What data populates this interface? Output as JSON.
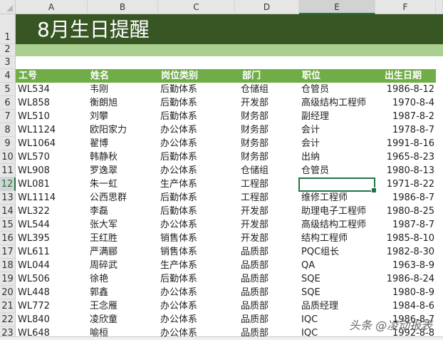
{
  "columns": [
    "A",
    "B",
    "C",
    "D",
    "E",
    "F"
  ],
  "title": "8月生日提醒",
  "headers": [
    "工号",
    "姓名",
    "岗位类别",
    "部门",
    "职位",
    "出生日期"
  ],
  "row_numbers": [
    "1",
    "2",
    "3",
    "4",
    "5",
    "6",
    "7",
    "8",
    "9",
    "10",
    "11",
    "12",
    "13",
    "14",
    "15",
    "16",
    "17",
    "18",
    "19",
    "20",
    "21",
    "22",
    "23"
  ],
  "rows": [
    [
      "WL534",
      "韦刚",
      "后勤体系",
      " 仓储组",
      " 仓管员",
      "1986-8-12"
    ],
    [
      "WL858",
      "衡朗旭",
      "后勤体系",
      " 开发部",
      " 高级结构工程师",
      "1970-8-4"
    ],
    [
      "WL510",
      "刘攀",
      "后勤体系",
      "财务部",
      "副经理",
      "1987-8-2"
    ],
    [
      "WL1124",
      "欧阳家力",
      "办公体系",
      "财务部",
      "会计",
      "1978-8-7"
    ],
    [
      "WL1064",
      "翟博",
      "办公体系",
      "财务部",
      "会计",
      "1991-8-16"
    ],
    [
      "WL570",
      "韩静秋",
      "后勤体系",
      "财务部",
      "出纳",
      "1965-8-23"
    ],
    [
      "WL908",
      "罗逸翠",
      "办公体系",
      "仓储组",
      "仓管员",
      "1980-8-13"
    ],
    [
      "WL081",
      "朱一虹",
      "生产体系",
      "工程部",
      "",
      "1971-8-22"
    ],
    [
      "WL1114",
      "公西思群",
      "后勤体系",
      "工程部",
      "维修工程师",
      "1986-8-7"
    ],
    [
      "WL322",
      "李磊",
      "后勤体系",
      "开发部",
      "助理电子工程师",
      "1980-8-25"
    ],
    [
      "WL544",
      "张大军",
      "办公体系",
      "开发部",
      "高级结构工程师",
      "1987-8-7"
    ],
    [
      "WL395",
      "王红胜",
      "销售体系",
      "开发部",
      "结构工程师",
      "1985-8-10"
    ],
    [
      "WL611",
      "严满郦",
      "销售体系",
      "品质部",
      "PQC组长",
      "1982-8-30"
    ],
    [
      "WL044",
      "周碎武",
      "生产体系",
      "品质部",
      "QA",
      "1963-8-9"
    ],
    [
      "WL506",
      "徐艳",
      "后勤体系",
      "品质部",
      "SQE",
      "1986-8-24"
    ],
    [
      "WL448",
      "郭鑫",
      "办公体系",
      "品质部",
      "SQE",
      "1980-8-9"
    ],
    [
      "WL772",
      "王念雁",
      "办公体系",
      "品质部",
      " 品质经理",
      "1984-8-6"
    ],
    [
      "WL840",
      "凌欣童",
      "办公体系",
      "品质部",
      "IQC",
      "1986-8-7"
    ],
    [
      "WL648",
      "喻桓",
      "办公体系",
      "品质部",
      "IQC",
      "1992-8-8"
    ]
  ],
  "watermark": "头条 @凌动报表",
  "colors": {
    "title_bg": "#375623",
    "band": "#a9d08e",
    "header_bg": "#70ad47"
  }
}
